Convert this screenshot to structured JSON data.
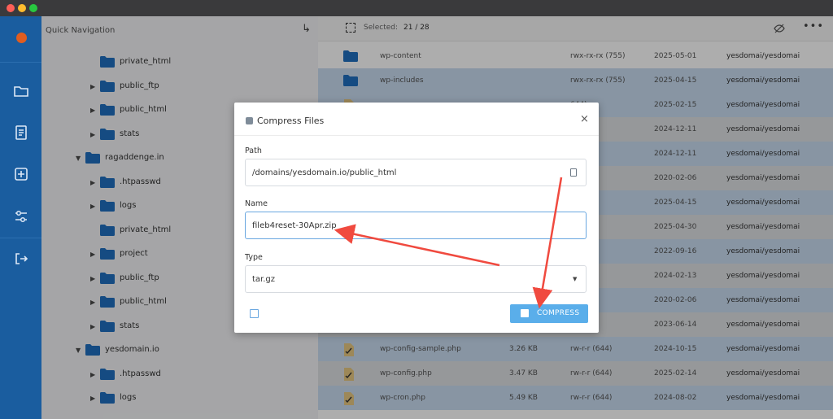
{
  "sidebar": {
    "quick_nav_title": "Quick Navigation",
    "tree": [
      {
        "name": "private_html",
        "indent": 1,
        "caret": false,
        "special": true
      },
      {
        "name": "public_ftp",
        "indent": 1,
        "caret": true
      },
      {
        "name": "public_html",
        "indent": 1,
        "caret": true
      },
      {
        "name": "stats",
        "indent": 1,
        "caret": true
      },
      {
        "name": "ragaddenge.in",
        "indent": 0,
        "caret": true,
        "open": true
      },
      {
        "name": ".htpasswd",
        "indent": 1,
        "caret": true
      },
      {
        "name": "logs",
        "indent": 1,
        "caret": true
      },
      {
        "name": "private_html",
        "indent": 1,
        "caret": false,
        "special": true
      },
      {
        "name": "project",
        "indent": 1,
        "caret": true
      },
      {
        "name": "public_ftp",
        "indent": 1,
        "caret": true
      },
      {
        "name": "public_html",
        "indent": 1,
        "caret": true
      },
      {
        "name": "stats",
        "indent": 1,
        "caret": true
      },
      {
        "name": "yesdomain.io",
        "indent": 0,
        "caret": true,
        "open": true
      },
      {
        "name": ".htpasswd",
        "indent": 1,
        "caret": true
      },
      {
        "name": "logs",
        "indent": 1,
        "caret": true
      }
    ]
  },
  "toolbar": {
    "selected_label": "Selected:",
    "selected_value": "21 / 28"
  },
  "files": [
    {
      "name": "wp-content",
      "size": "",
      "perm": "rwx-rx-rx (755)",
      "date": "2025-05-01",
      "owner": "yesdomai/yesdomai",
      "type": "folder",
      "sel": false
    },
    {
      "name": "wp-includes",
      "size": "",
      "perm": "rwx-rx-rx (755)",
      "date": "2025-04-15",
      "owner": "yesdomai/yesdomai",
      "type": "folder",
      "sel": true
    },
    {
      "name": "",
      "size": "",
      "perm": "644)",
      "date": "2025-02-15",
      "owner": "yesdomai/yesdomai",
      "type": "file",
      "sel": true
    },
    {
      "name": "",
      "size": "",
      "perm": "644)",
      "date": "2024-12-11",
      "owner": "yesdomai/yesdomai",
      "type": "file",
      "sel": false
    },
    {
      "name": "",
      "size": "",
      "perm": "644)",
      "date": "2024-12-11",
      "owner": "yesdomai/yesdomai",
      "type": "file",
      "sel": true
    },
    {
      "name": "",
      "size": "",
      "perm": "644)",
      "date": "2020-02-06",
      "owner": "yesdomai/yesdomai",
      "type": "file",
      "sel": false
    },
    {
      "name": "",
      "size": "",
      "perm": "644)",
      "date": "2025-04-15",
      "owner": "yesdomai/yesdomai",
      "type": "file",
      "sel": true
    },
    {
      "name": "",
      "size": "",
      "perm": "644)",
      "date": "2025-04-30",
      "owner": "yesdomai/yesdomai",
      "type": "file",
      "sel": false
    },
    {
      "name": "",
      "size": "",
      "perm": "644)",
      "date": "2022-09-16",
      "owner": "yesdomai/yesdomai",
      "type": "file",
      "sel": true
    },
    {
      "name": "",
      "size": "",
      "perm": "644)",
      "date": "2024-02-13",
      "owner": "yesdomai/yesdomai",
      "type": "file",
      "sel": false
    },
    {
      "name": "",
      "size": "",
      "perm": "644)",
      "date": "2020-02-06",
      "owner": "yesdomai/yesdomai",
      "type": "file",
      "sel": true
    },
    {
      "name": "",
      "size": "",
      "perm": "644)",
      "date": "2023-06-14",
      "owner": "yesdomai/yesdomai",
      "type": "file",
      "sel": false
    },
    {
      "name": "wp-config-sample.php",
      "size": "3.26 KB",
      "perm": "rw-r-r (644)",
      "date": "2024-10-15",
      "owner": "yesdomai/yesdomai",
      "type": "file",
      "sel": true
    },
    {
      "name": "wp-config.php",
      "size": "3.47 KB",
      "perm": "rw-r-r (644)",
      "date": "2025-02-14",
      "owner": "yesdomai/yesdomai",
      "type": "file",
      "sel": false
    },
    {
      "name": "wp-cron.php",
      "size": "5.49 KB",
      "perm": "rw-r-r (644)",
      "date": "2024-08-02",
      "owner": "yesdomai/yesdomai",
      "type": "file",
      "sel": true
    }
  ],
  "modal": {
    "title": "Compress Files",
    "close": "×",
    "path_label": "Path",
    "path_value": "/domains/yesdomain.io/public_html",
    "name_label": "Name",
    "name_value": "fileb4reset-30Apr.zip",
    "type_label": "Type",
    "type_value": "tar.gz",
    "compress_label": "COMPRESS"
  },
  "colors": {
    "rail": "#1a5d9f",
    "accent": "#5aaeea",
    "folder": "#1f6fc0",
    "arrow": "#f04a3f"
  },
  "icons": {
    "rail": [
      "logo-icon",
      "folder-icon",
      "document-icon",
      "add-icon",
      "settings-sliders-icon",
      "logout-icon"
    ]
  }
}
